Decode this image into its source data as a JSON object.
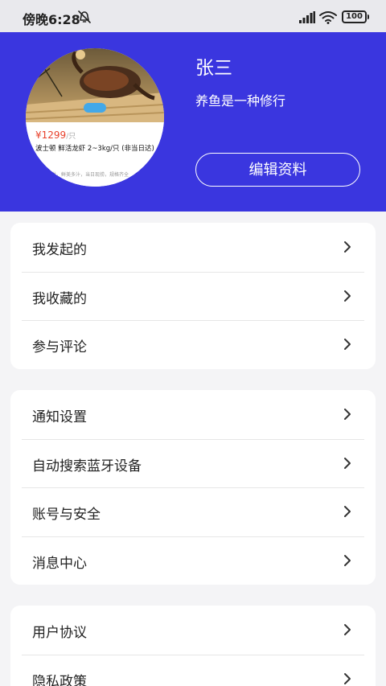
{
  "status_bar": {
    "time": "傍晚6:28",
    "battery": "100"
  },
  "profile": {
    "name": "张三",
    "bio": "养鱼是一种修行",
    "edit_label": "编辑资料",
    "avatar": {
      "price": "¥1299",
      "unit": "/只",
      "title": "波士顿 鲜活龙虾 2~3kg/只 (非当日达)",
      "desc": "产地直发，鲜美多汁，当日现捞，规格齐全"
    }
  },
  "groups": [
    {
      "items": [
        {
          "label": "我发起的"
        },
        {
          "label": "我收藏的"
        },
        {
          "label": "参与评论"
        }
      ]
    },
    {
      "items": [
        {
          "label": "通知设置"
        },
        {
          "label": "自动搜索蓝牙设备"
        },
        {
          "label": "账号与安全"
        },
        {
          "label": "消息中心"
        }
      ]
    },
    {
      "items": [
        {
          "label": "用户协议"
        },
        {
          "label": "隐私政策"
        }
      ]
    }
  ],
  "colors": {
    "header": "#3a36df",
    "background": "#f4f4f6",
    "status_bar": "#e9e9ed"
  },
  "icons": {
    "mute": "bell-off-icon",
    "signal": "signal-icon",
    "wifi": "wifi-icon",
    "chevron": "chevron-right-icon"
  }
}
